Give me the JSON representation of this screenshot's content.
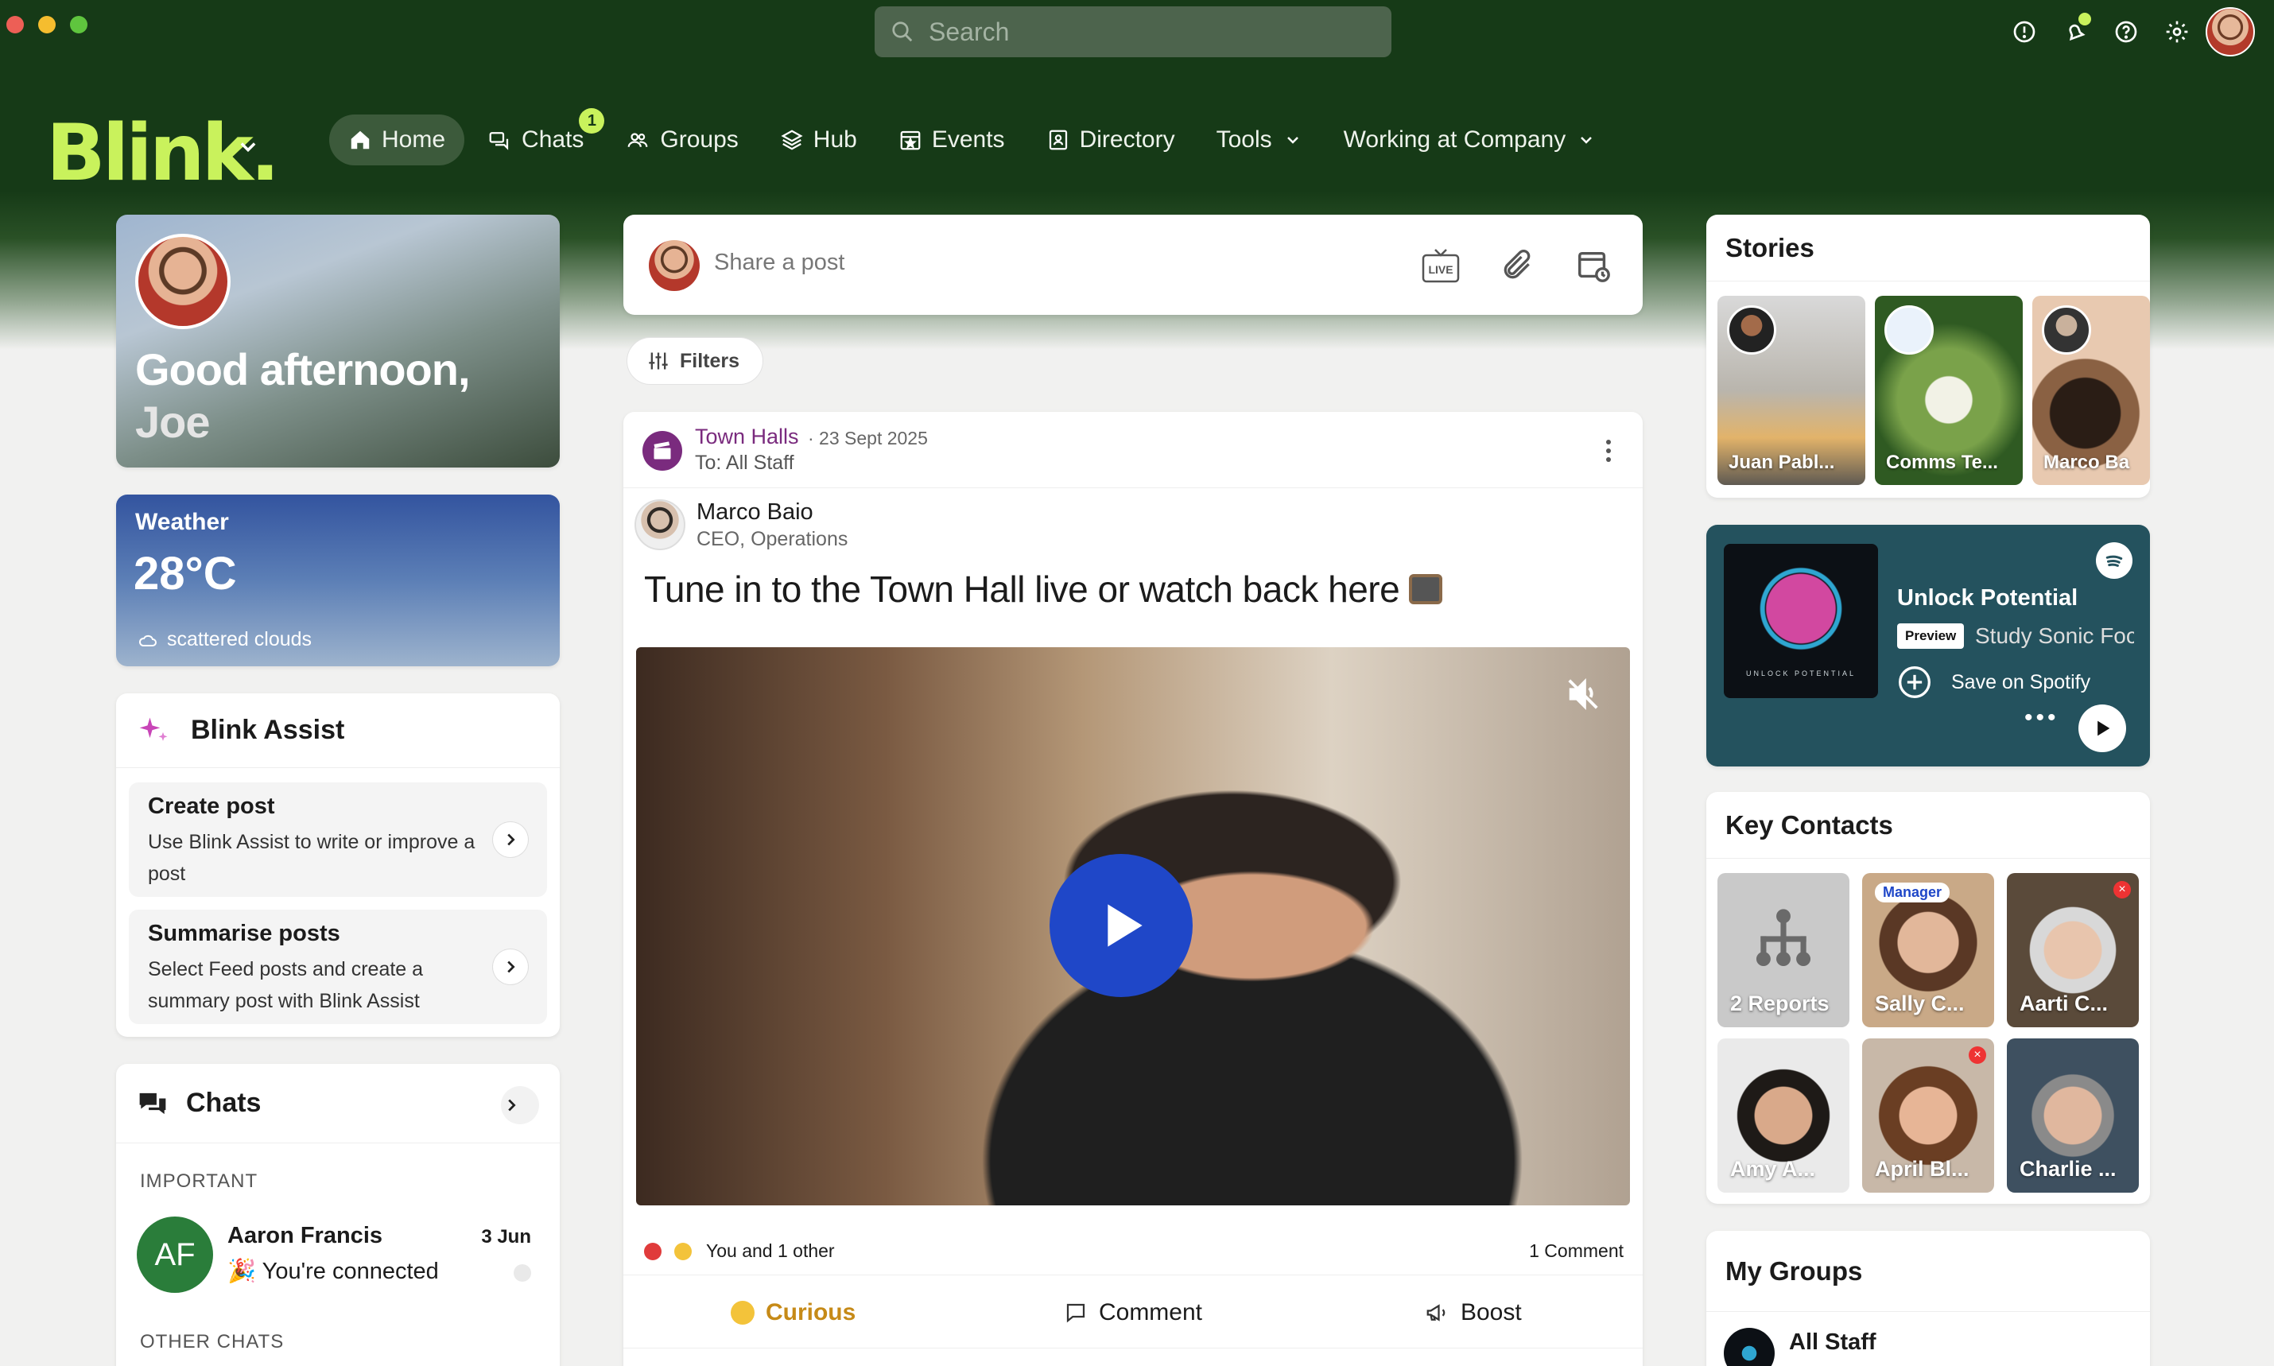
{
  "app": {
    "search_placeholder": "Search",
    "logo": "Blink."
  },
  "nav": {
    "items": [
      {
        "label": "Home",
        "icon": "home-icon",
        "active": true
      },
      {
        "label": "Chats",
        "icon": "chat-icon",
        "badge": "1"
      },
      {
        "label": "Groups",
        "icon": "groups-icon"
      },
      {
        "label": "Hub",
        "icon": "layers-icon"
      },
      {
        "label": "Events",
        "icon": "calendar-icon"
      },
      {
        "label": "Directory",
        "icon": "contact-card-icon"
      },
      {
        "label": "Tools",
        "icon": "chevron-down-icon"
      },
      {
        "label": "Working at Company",
        "icon": "chevron-down-icon"
      }
    ]
  },
  "greeting": {
    "line1": "Good afternoon,",
    "name": "Joe"
  },
  "weather": {
    "label": "Weather",
    "temp": "28°C",
    "desc": "scattered clouds"
  },
  "assist": {
    "title": "Blink Assist",
    "items": [
      {
        "title": "Create post",
        "desc": "Use Blink Assist to write or improve a post"
      },
      {
        "title": "Summarise posts",
        "desc": "Select Feed posts and create a summary post with Blink Assist"
      }
    ]
  },
  "chats": {
    "title": "Chats",
    "important_label": "IMPORTANT",
    "item": {
      "initials": "AF",
      "name": "Aaron Francis",
      "message": "🎉 You're connected",
      "date": "3 Jun"
    },
    "other_label": "OTHER CHATS"
  },
  "composer": {
    "placeholder": "Share a post",
    "live_label": "LIVE"
  },
  "filters": {
    "label": "Filters"
  },
  "post": {
    "channel": "Town Halls",
    "date": "· 23 Sept 2025",
    "audience": "To: All Staff",
    "author": "Marco Baio",
    "role": "CEO, Operations",
    "title": "Tune in to the Town Hall live or watch back here",
    "reactions": "You and 1 other",
    "comments": "1 Comment",
    "actions": {
      "curious": "Curious",
      "comment": "Comment",
      "boost": "Boost"
    }
  },
  "stories": {
    "title": "Stories",
    "items": [
      {
        "label": "Juan Pabl..."
      },
      {
        "label": "Comms Te..."
      },
      {
        "label": "Marco Ba"
      }
    ]
  },
  "spotify": {
    "art_label": "UNLOCK POTENTIAL",
    "title": "Unlock Potential",
    "preview": "Preview",
    "track": "Study Sonic Focus",
    "save": "Save on Spotify",
    "dots": "•••"
  },
  "contacts": {
    "title": "Key Contacts",
    "items": [
      {
        "label": "2 Reports"
      },
      {
        "label": "Sally C...",
        "badge": "Manager"
      },
      {
        "label": "Aarti C..."
      },
      {
        "label": "Amy A..."
      },
      {
        "label": "April Bl..."
      },
      {
        "label": "Charlie ..."
      }
    ]
  },
  "groups": {
    "title": "My Groups",
    "item": "All Staff"
  },
  "colors": {
    "brand_green": "#163a17",
    "accent_lime": "#c9f25c",
    "play_blue": "#1f47c8",
    "spotify_bg": "#24525e"
  }
}
